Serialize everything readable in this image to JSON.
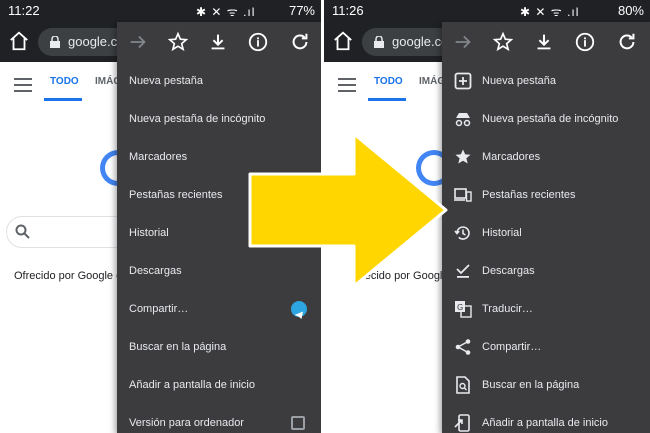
{
  "left": {
    "status": {
      "time": "11:22",
      "icons": "✱ ✕ ᯤ .ıl",
      "battery": "77%"
    },
    "toolbar": {
      "url": "google.com"
    },
    "page": {
      "tab_all": "TODO",
      "tab_images": "IMÁG",
      "offered": "Ofrecido por Google en"
    },
    "menu": {
      "items": [
        {
          "label": "Nueva pestaña"
        },
        {
          "label": "Nueva pestaña de incógnito"
        },
        {
          "label": "Marcadores"
        },
        {
          "label": "Pestañas recientes"
        },
        {
          "label": "Historial"
        },
        {
          "label": "Descargas"
        },
        {
          "label": "Compartir…"
        },
        {
          "label": "Buscar en la página"
        },
        {
          "label": "Añadir a pantalla de inicio"
        },
        {
          "label": "Versión para ordenador"
        }
      ]
    }
  },
  "right": {
    "status": {
      "time": "11:26",
      "icons": "✱ ✕ ᯤ .ıl",
      "battery": "80%"
    },
    "toolbar": {
      "url": "google.com"
    },
    "page": {
      "tab_all": "TODO",
      "tab_images": "IMÁG",
      "offered": "frecido por Google en"
    },
    "menu": {
      "items": [
        {
          "label": "Nueva pestaña",
          "icon": "plus-box-icon"
        },
        {
          "label": "Nueva pestaña de incógnito",
          "icon": "incognito-icon"
        },
        {
          "label": "Marcadores",
          "icon": "star-filled-icon"
        },
        {
          "label": "Pestañas recientes",
          "icon": "devices-icon"
        },
        {
          "label": "Historial",
          "icon": "history-icon"
        },
        {
          "label": "Descargas",
          "icon": "download-done-icon"
        },
        {
          "label": "Traducir…",
          "icon": "translate-icon"
        },
        {
          "label": "Compartir…",
          "icon": "share-icon"
        },
        {
          "label": "Buscar en la página",
          "icon": "find-in-page-icon"
        },
        {
          "label": "Añadir a pantalla de inicio",
          "icon": "add-to-home-icon"
        }
      ]
    }
  },
  "colors": {
    "arrow": "#ffd600",
    "menu_bg": "#3c3c3f",
    "toolbar_bg": "#202124",
    "accent": "#1a73e8"
  }
}
